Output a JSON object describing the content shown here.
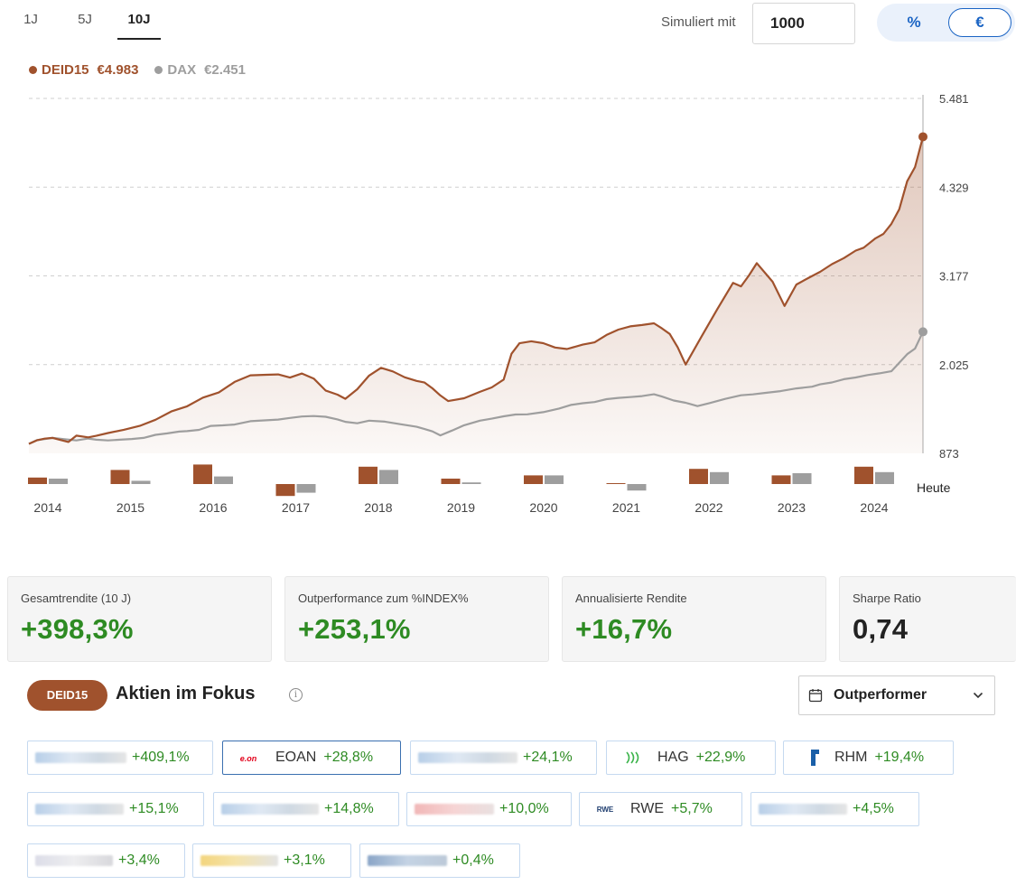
{
  "periods": [
    "1J",
    "5J",
    "10J"
  ],
  "active_period": "10J",
  "simulation": {
    "label": "Simuliert mit",
    "value": "1000"
  },
  "unit_toggle": {
    "percent": "%",
    "euro": "€",
    "active": "€"
  },
  "legend": [
    {
      "name": "DEID15",
      "value": "€4.983",
      "color": "#a0522d"
    },
    {
      "name": "DAX",
      "value": "€2.451",
      "color": "#9e9e9e"
    }
  ],
  "chart_data": {
    "type": "line",
    "y_ticks": [
      "5.481",
      "4.329",
      "3.177",
      "2.025",
      "873"
    ],
    "ylim": [
      873,
      5481
    ],
    "x_labels": [
      "2014",
      "2015",
      "2016",
      "2017",
      "2018",
      "2019",
      "2020",
      "2021",
      "2022",
      "2023",
      "2024"
    ],
    "x_end_label": "Heute",
    "series": [
      {
        "name": "DEID15",
        "color": "#a0522d",
        "x": [
          2014.0,
          2014.1,
          2014.2,
          2014.3,
          2014.4,
          2014.5,
          2014.6,
          2014.75,
          2014.85,
          2015.0,
          2015.2,
          2015.4,
          2015.6,
          2015.8,
          2016.0,
          2016.2,
          2016.4,
          2016.6,
          2016.8,
          2017.0,
          2017.15,
          2017.3,
          2017.45,
          2017.6,
          2017.75,
          2017.9,
          2018.0,
          2018.15,
          2018.3,
          2018.45,
          2018.6,
          2018.75,
          2018.9,
          2019.0,
          2019.1,
          2019.2,
          2019.3,
          2019.5,
          2019.7,
          2019.85,
          2020.0,
          2020.1,
          2020.2,
          2020.35,
          2020.5,
          2020.65,
          2020.8,
          2021.0,
          2021.15,
          2021.3,
          2021.45,
          2021.6,
          2021.75,
          2021.9,
          2022.0,
          2022.1,
          2022.2,
          2022.3,
          2022.5,
          2022.7,
          2022.9,
          2023.0,
          2023.1,
          2023.2,
          2023.4,
          2023.55,
          2023.7,
          2023.85,
          2024.0,
          2024.15,
          2024.3,
          2024.45,
          2024.55,
          2024.7,
          2024.8,
          2024.9,
          2025.0,
          2025.1,
          2025.2,
          2025.3
        ],
        "y": [
          996,
          1042,
          1064,
          1073,
          1046,
          1021,
          1103,
          1081,
          1101,
          1137,
          1179,
          1230,
          1309,
          1417,
          1484,
          1597,
          1663,
          1801,
          1886,
          1893,
          1898,
          1857,
          1909,
          1844,
          1689,
          1635,
          1581,
          1705,
          1882,
          1983,
          1936,
          1860,
          1813,
          1792,
          1717,
          1625,
          1552,
          1588,
          1671,
          1729,
          1831,
          2166,
          2302,
          2328,
          2303,
          2247,
          2227,
          2285,
          2314,
          2410,
          2479,
          2522,
          2539,
          2562,
          2496,
          2423,
          2249,
          2026,
          2388,
          2744,
          3087,
          3041,
          3183,
          3342,
          3101,
          2786,
          3064,
          3149,
          3230,
          3329,
          3408,
          3505,
          3543,
          3665,
          3722,
          3852,
          4041,
          4406,
          4590,
          4983
        ]
      },
      {
        "name": "DAX",
        "color": "#9e9e9e",
        "x": [
          2014.0,
          2014.1,
          2014.2,
          2014.3,
          2014.45,
          2014.6,
          2014.75,
          2014.85,
          2015.0,
          2015.15,
          2015.3,
          2015.45,
          2015.6,
          2015.75,
          2015.9,
          2016.0,
          2016.15,
          2016.3,
          2016.45,
          2016.6,
          2016.8,
          2017.0,
          2017.15,
          2017.3,
          2017.45,
          2017.6,
          2017.75,
          2017.9,
          2018.0,
          2018.15,
          2018.3,
          2018.5,
          2018.7,
          2018.9,
          2019.0,
          2019.1,
          2019.2,
          2019.35,
          2019.5,
          2019.7,
          2019.85,
          2020.0,
          2020.15,
          2020.3,
          2020.5,
          2020.7,
          2020.85,
          2021.0,
          2021.15,
          2021.3,
          2021.45,
          2021.6,
          2021.75,
          2021.9,
          2022.0,
          2022.15,
          2022.3,
          2022.45,
          2022.6,
          2022.8,
          2023.0,
          2023.15,
          2023.3,
          2023.5,
          2023.7,
          2023.9,
          2024.0,
          2024.15,
          2024.3,
          2024.45,
          2024.6,
          2024.75,
          2024.9,
          2025.0,
          2025.1,
          2025.2,
          2025.3
        ],
        "y": [
          996,
          1044,
          1060,
          1073,
          1057,
          1041,
          1065,
          1050,
          1041,
          1050,
          1059,
          1074,
          1113,
          1132,
          1156,
          1162,
          1178,
          1230,
          1237,
          1247,
          1290,
          1302,
          1311,
          1333,
          1351,
          1357,
          1348,
          1314,
          1282,
          1263,
          1297,
          1284,
          1251,
          1218,
          1188,
          1158,
          1106,
          1170,
          1238,
          1297,
          1323,
          1354,
          1377,
          1379,
          1408,
          1455,
          1502,
          1524,
          1539,
          1577,
          1593,
          1603,
          1616,
          1640,
          1611,
          1559,
          1530,
          1486,
          1525,
          1580,
          1627,
          1639,
          1658,
          1681,
          1716,
          1738,
          1769,
          1793,
          1836,
          1858,
          1889,
          1912,
          1939,
          2048,
          2161,
          2233,
          2451
        ]
      }
    ],
    "annual_bars": {
      "DEID15": [
        0.6,
        1.3,
        1.8,
        -1.1,
        1.6,
        0.5,
        0.8,
        0.05,
        1.4,
        0.8,
        1.6
      ],
      "DAX": [
        0.5,
        0.3,
        0.7,
        -0.8,
        1.3,
        0.15,
        0.8,
        -0.6,
        1.1,
        1.0,
        1.1
      ],
      "colors": [
        "#a0522d",
        "#9e9e9e"
      ]
    }
  },
  "kpis": [
    {
      "label": "Gesamtrendite (10 J)",
      "value": "+398,3%"
    },
    {
      "label": "Outperformance zum %INDEX%",
      "value": "+253,1%"
    },
    {
      "label": "Annualisierte Rendite",
      "value": "+16,7%"
    },
    {
      "label": "Sharpe Ratio",
      "value": "0,74"
    }
  ],
  "focus": {
    "badge": "DEID15",
    "title": "Aktien im Fokus",
    "info_icon": "info-icon",
    "dropdown_label": "Outperformer",
    "dropdown_icons": [
      "calendar-icon",
      "chevron-down-icon"
    ]
  },
  "stocks": [
    {
      "name": "",
      "change": "+409,1%"
    },
    {
      "name": "EOAN",
      "change": "+28,8%"
    },
    {
      "name": "",
      "change": "+24,1%"
    },
    {
      "name": "HAG",
      "change": "+22,9%"
    },
    {
      "name": "RHM",
      "change": "+19,4%"
    },
    {
      "name": "",
      "change": "+15,1%"
    },
    {
      "name": "",
      "change": "+14,8%"
    },
    {
      "name": "",
      "change": "+10,0%"
    },
    {
      "name": "RWE",
      "change": "+5,7%"
    },
    {
      "name": "",
      "change": "+4,5%"
    },
    {
      "name": "",
      "change": "+3,4%"
    },
    {
      "name": "",
      "change": "+3,1%"
    },
    {
      "name": "",
      "change": "+0,4%"
    }
  ],
  "logo_text": {
    "eon": "e.on",
    "rwe": "RWE"
  }
}
